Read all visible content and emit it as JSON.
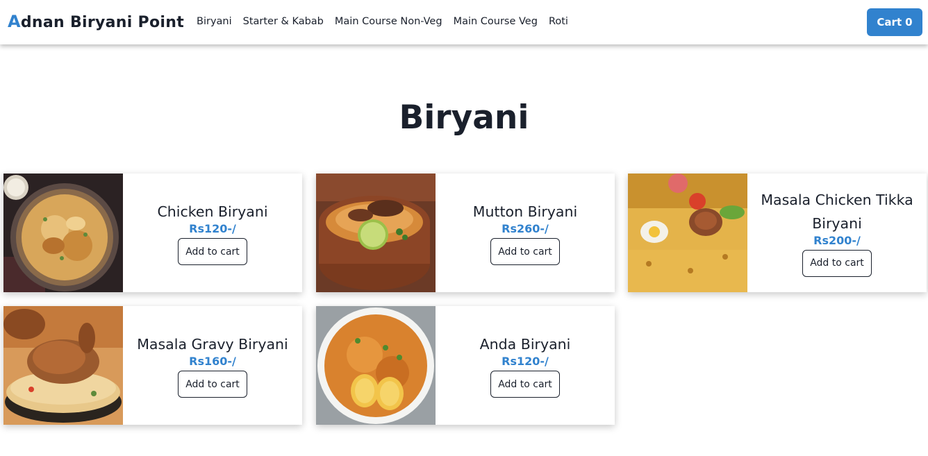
{
  "brand": {
    "initial": "A",
    "rest": "dnan Biryani Point"
  },
  "nav": {
    "links": [
      "Biryani",
      "Starter & Kabab",
      "Main Course Non-Veg",
      "Main Course Veg",
      "Roti"
    ]
  },
  "cart": {
    "label": "Cart",
    "count": "0"
  },
  "section": {
    "title": "Biryani"
  },
  "items": [
    {
      "name": "Chicken Biryani",
      "price": "Rs120-/",
      "button": "Add to cart",
      "image": "chicken-biryani-plate"
    },
    {
      "name": "Mutton Biryani",
      "price": "Rs260-/",
      "button": "Add to cart",
      "image": "mutton-biryani-pot"
    },
    {
      "name": "Masala Chicken Tikka Biryani",
      "price": "Rs200-/",
      "button": "Add to cart",
      "image": "chicken-tikka-biryani"
    },
    {
      "name": "Masala Gravy Biryani",
      "price": "Rs160-/",
      "button": "Add to cart",
      "image": "masala-gravy-biryani"
    },
    {
      "name": "Anda Biryani",
      "price": "Rs120-/",
      "button": "Add to cart",
      "image": "anda-biryani-bowl"
    }
  ],
  "colors": {
    "accent": "#3182ce",
    "text": "#1a202c",
    "background": "#ffffff"
  }
}
